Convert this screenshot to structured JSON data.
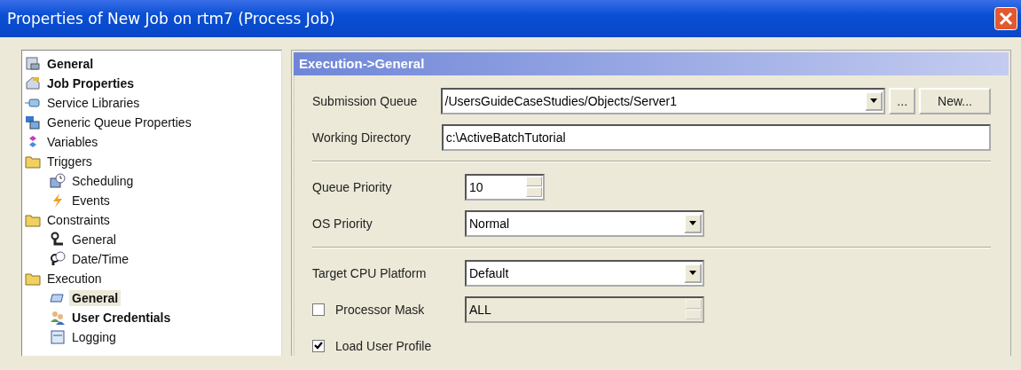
{
  "window": {
    "title": "Properties of New Job  on rtm7 (Process Job)"
  },
  "tree": [
    {
      "label": "General",
      "bold": true,
      "selected": false
    },
    {
      "label": "Job Properties",
      "bold": true,
      "selected": false
    },
    {
      "label": "Service Libraries",
      "bold": false,
      "selected": false
    },
    {
      "label": "Generic Queue Properties",
      "bold": false,
      "selected": false
    },
    {
      "label": "Variables",
      "bold": false,
      "selected": false
    },
    {
      "label": "Triggers",
      "bold": false,
      "selected": false,
      "children": [
        {
          "label": "Scheduling",
          "bold": false,
          "selected": false
        },
        {
          "label": "Events",
          "bold": false,
          "selected": false
        }
      ]
    },
    {
      "label": "Constraints",
      "bold": false,
      "selected": false,
      "children": [
        {
          "label": "General",
          "bold": false,
          "selected": false
        },
        {
          "label": "Date/Time",
          "bold": false,
          "selected": false
        }
      ]
    },
    {
      "label": "Execution",
      "bold": false,
      "selected": false,
      "children": [
        {
          "label": "General",
          "bold": true,
          "selected": true
        },
        {
          "label": "User Credentials",
          "bold": true,
          "selected": false
        },
        {
          "label": "Logging",
          "bold": false,
          "selected": false
        }
      ]
    }
  ],
  "panel": {
    "title": "Execution->General",
    "rows": [
      {
        "kind": "combo",
        "label": "Submission Queue",
        "value": "/UsersGuideCaseStudies/Objects/Server1",
        "buttons": [
          "...",
          "New..."
        ]
      },
      {
        "kind": "text",
        "label": "Working Directory",
        "value": "c:\\ActiveBatchTutorial"
      },
      {
        "kind": "separator"
      },
      {
        "kind": "spin",
        "label": "Queue Priority",
        "value": "10"
      },
      {
        "kind": "select",
        "label": "OS Priority",
        "value": "Normal"
      },
      {
        "kind": "separator"
      },
      {
        "kind": "select",
        "label": "Target CPU Platform",
        "value": "Default"
      },
      {
        "kind": "check_spin",
        "label": "Processor Mask",
        "checked": false,
        "value": "ALL",
        "disabled": true
      },
      {
        "kind": "check",
        "label": "Load User Profile",
        "checked": true
      }
    ]
  }
}
